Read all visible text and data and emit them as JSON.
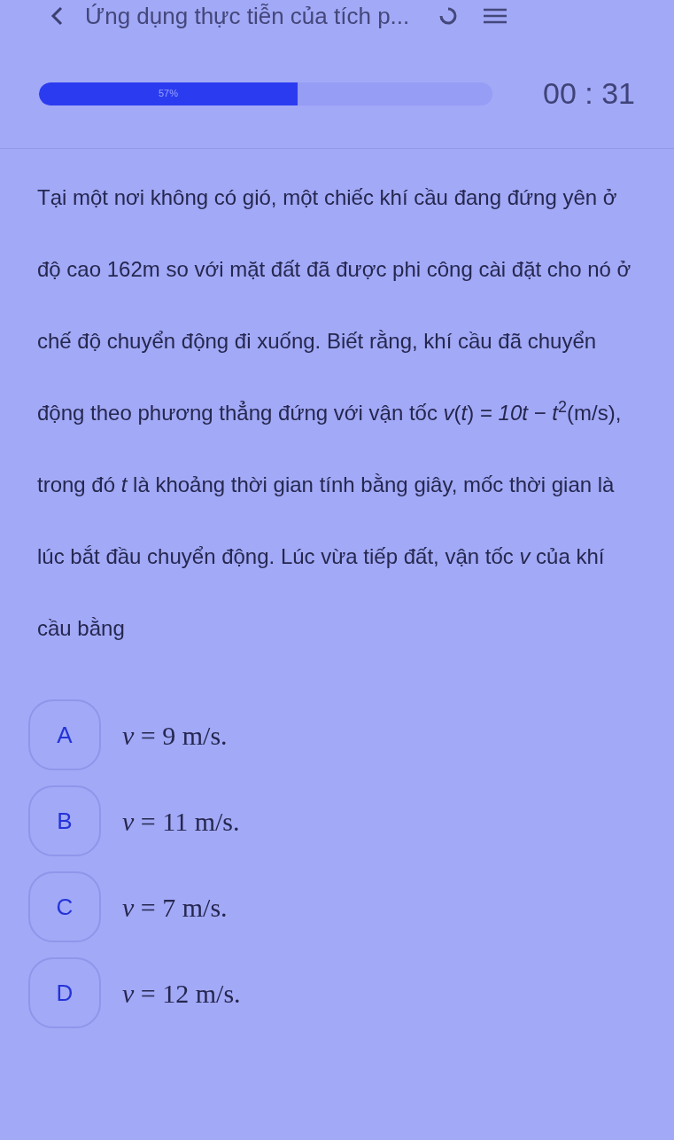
{
  "header": {
    "title": "Ứng dụng thực tiễn của tích p..."
  },
  "progress": {
    "level": 0.57,
    "label": "57%"
  },
  "timer": "00 : 31",
  "question": "Tại một nơi không có gió, một chiếc khí cầu đang đứng yên ở độ cao 162m so với mặt đất đã được phi công cài đặt cho nó ở chế độ chuyển động đi xuống. Biết rằng, khí cầu đã chuyển động theo phương thẳng đứng với vận tốc *v*(*t*) = *10t* − *t*$^{2}$(m/s), trong đó *t* là khoảng thời gian tính bằng giây, mốc thời gian là lúc bắt đầu chuyển động. Lúc vừa tiếp đất, vận tốc *v* của khí cầu bằng",
  "options": [
    {
      "letter": "A",
      "text": "*v* = 9 m/s.",
      "selected": false
    },
    {
      "letter": "B",
      "text": "*v* = 11 m/s.",
      "selected": false
    },
    {
      "letter": "C",
      "text": "*v* = 7 m/s.",
      "selected": false
    },
    {
      "letter": "D",
      "text": "*v* = 12 m/s.",
      "selected": false
    }
  ]
}
